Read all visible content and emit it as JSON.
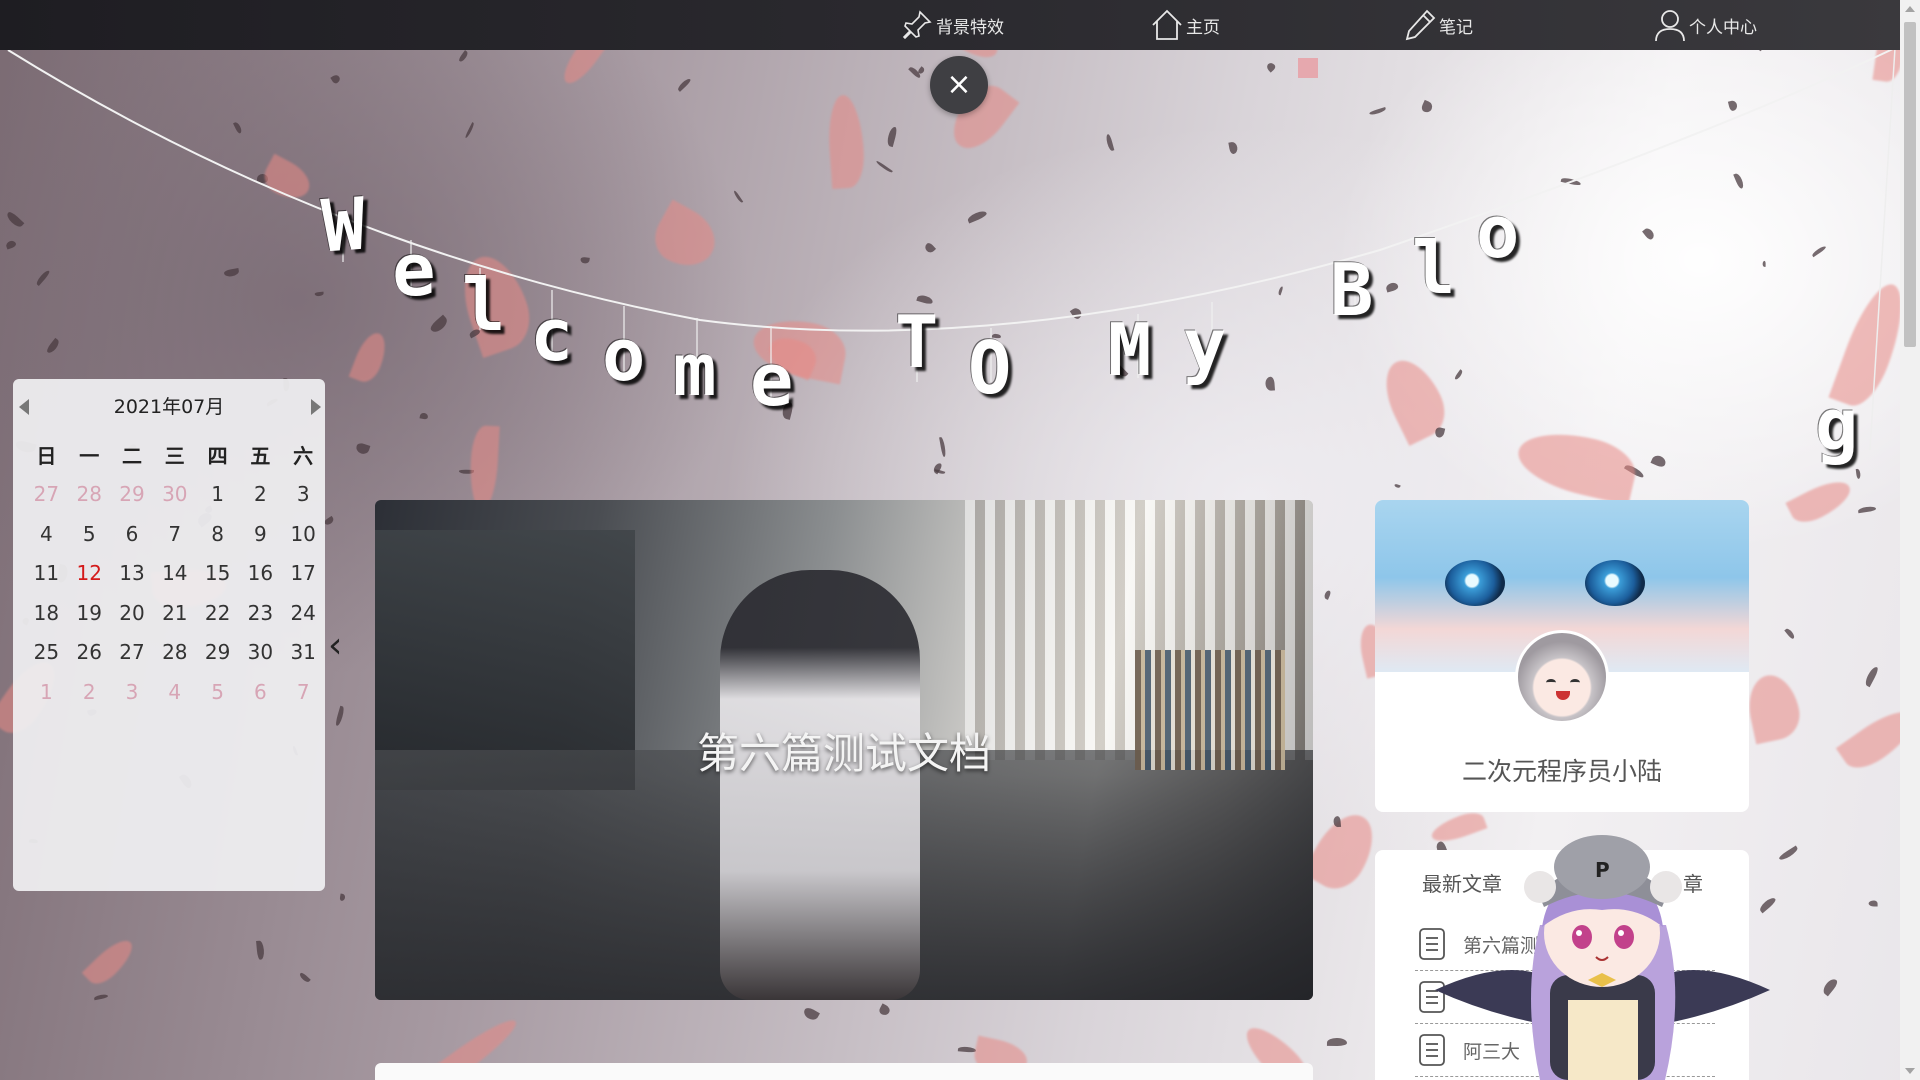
{
  "nav": {
    "items": [
      {
        "label": "背景特效",
        "icon": "pin-icon"
      },
      {
        "label": "主页",
        "icon": "home-icon"
      },
      {
        "label": "笔记",
        "icon": "pencil-icon"
      },
      {
        "label": "个人中心",
        "icon": "user-icon"
      }
    ]
  },
  "close_button": {
    "label": "×"
  },
  "banner": {
    "letters": [
      "W",
      "e",
      "l",
      "c",
      "o",
      "m",
      "e",
      "T",
      "O",
      "M",
      "y",
      "B",
      "l",
      "o",
      "g"
    ]
  },
  "calendar": {
    "month_label": "2021年07月",
    "weekdays": [
      "日",
      "一",
      "二",
      "三",
      "四",
      "五",
      "六"
    ],
    "weeks": [
      [
        "27",
        "28",
        "29",
        "30",
        "1",
        "2",
        "3"
      ],
      [
        "4",
        "5",
        "6",
        "7",
        "8",
        "9",
        "10"
      ],
      [
        "11",
        "12",
        "13",
        "14",
        "15",
        "16",
        "17"
      ],
      [
        "18",
        "19",
        "20",
        "21",
        "22",
        "23",
        "24"
      ],
      [
        "25",
        "26",
        "27",
        "28",
        "29",
        "30",
        "31"
      ],
      [
        "1",
        "2",
        "3",
        "4",
        "5",
        "6",
        "7"
      ]
    ],
    "today": "12"
  },
  "carousel": {
    "prev_label": "‹"
  },
  "feature": {
    "title": "第六篇测试文档"
  },
  "profile": {
    "name": "二次元程序员小陆"
  },
  "latest_articles": {
    "title": "最新文章",
    "title_right": "章",
    "items": [
      {
        "label": "第六篇测"
      },
      {
        "label": "阿"
      },
      {
        "label": "阿三大"
      }
    ]
  },
  "colors": {
    "nav_bg": "#2b2a2f",
    "today": "#d41a1a",
    "muted_day": "#d7a5b5"
  }
}
